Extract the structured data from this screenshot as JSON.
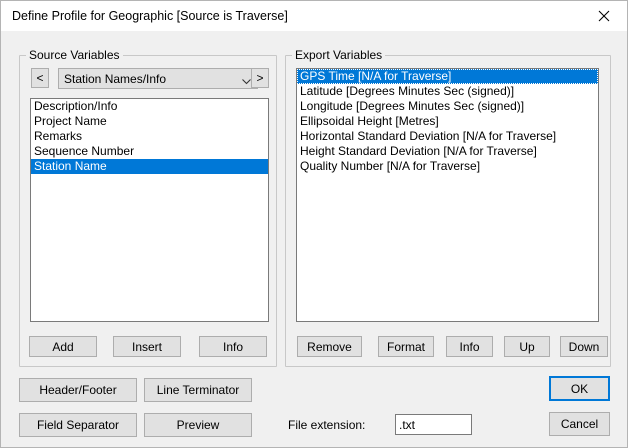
{
  "window": {
    "title": "Define Profile for Geographic [Source is Traverse]",
    "close_icon": "close-icon"
  },
  "source": {
    "legend": "Source Variables",
    "prev_label": "<",
    "next_label": ">",
    "category_selected": "Station Names/Info",
    "items": [
      "Description/Info",
      "Project Name",
      "Remarks",
      "Sequence Number",
      "Station Name"
    ],
    "selected_item": "Station Name",
    "buttons": {
      "add": "Add",
      "insert": "Insert",
      "info": "Info"
    }
  },
  "export": {
    "legend": "Export Variables",
    "items": [
      "GPS Time [N/A for Traverse]",
      "Latitude [Degrees Minutes Sec (signed)]",
      "Longitude [Degrees Minutes Sec (signed)]",
      "Ellipsoidal Height [Metres]",
      "Horizontal Standard Deviation [N/A for Traverse]",
      "Height Standard Deviation [N/A for Traverse]",
      "Quality Number [N/A for Traverse]"
    ],
    "selected_item": "GPS Time [N/A for Traverse]",
    "buttons": {
      "remove": "Remove",
      "format": "Format",
      "info": "Info",
      "up": "Up",
      "down": "Down"
    }
  },
  "bottom": {
    "header_footer": "Header/Footer",
    "line_terminator": "Line Terminator",
    "field_separator": "Field Separator",
    "preview": "Preview",
    "file_extension_label": "File extension:",
    "file_extension_value": ".txt",
    "ok": "OK",
    "cancel": "Cancel"
  },
  "colors": {
    "selection": "#0078d7",
    "dialog_bg": "#f0f0f0",
    "button_bg": "#e1e1e1"
  }
}
